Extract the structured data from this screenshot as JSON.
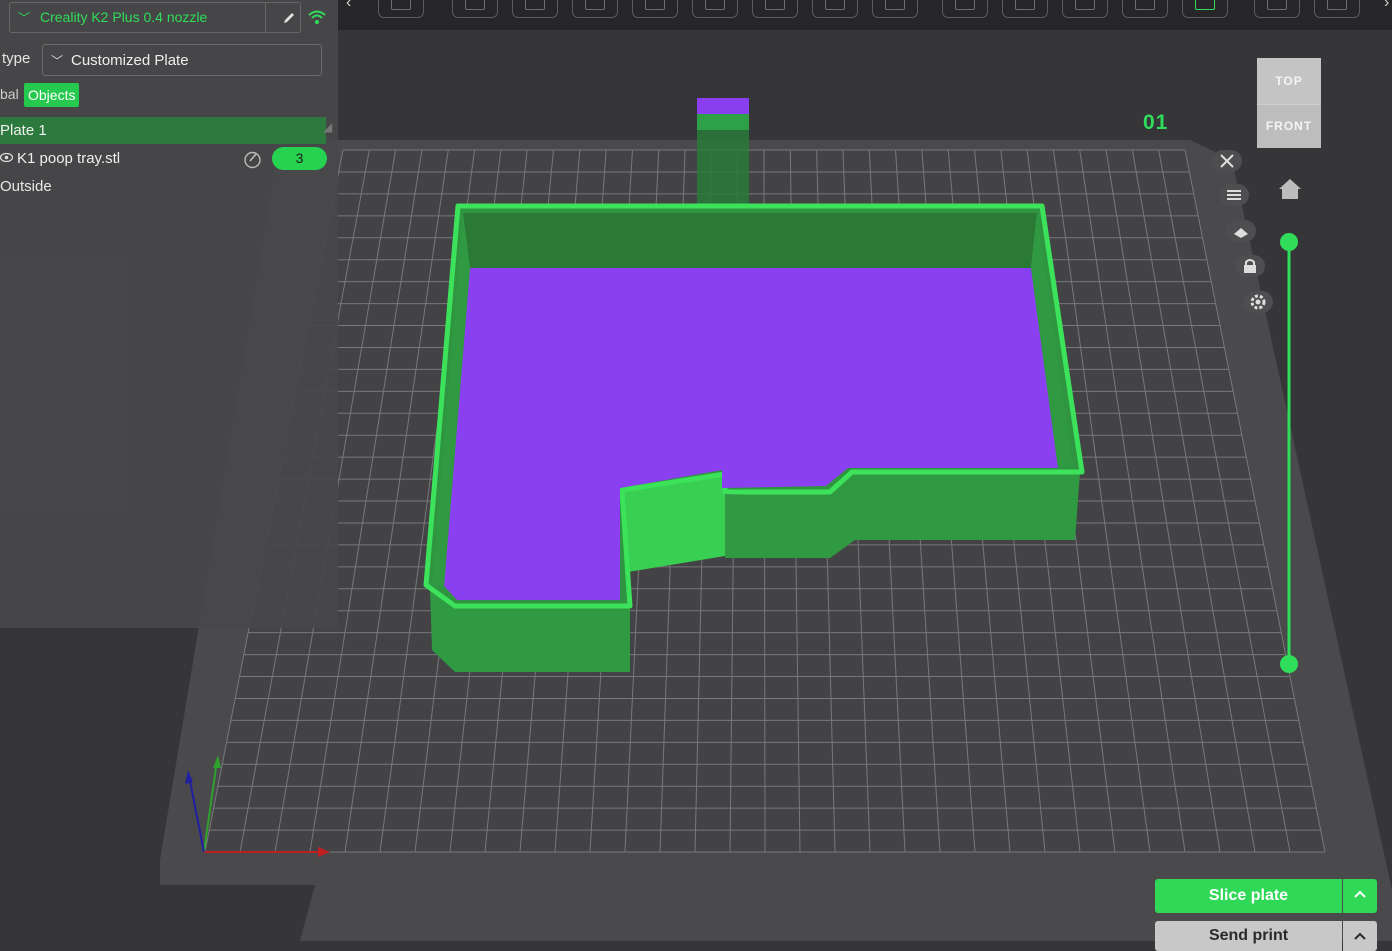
{
  "toolbar": {
    "buttons": [
      "add-icon",
      "arrange-icon",
      "orient-icon",
      "cut-icon",
      "layers-icon",
      "paint-icon",
      "support-icon",
      "scale-icon",
      "measure-icon",
      "seam-icon",
      "fill-icon",
      "text-icon",
      "plate-icon",
      "auto-icon",
      "printer-icon"
    ]
  },
  "left_panel": {
    "printer": "Creality K2 Plus 0.4 nozzle",
    "plate_type_label": "type",
    "plate_type_value": "Customized Plate",
    "tab_global": "bal",
    "tab_objects": "Objects",
    "plate": "Plate 1",
    "object_name": "K1 poop tray.stl",
    "object_count": "3",
    "outside": "Outside"
  },
  "viewport": {
    "plate_number": "01",
    "navcube_top": "TOP",
    "navcube_front": "FRONT"
  },
  "actions": {
    "slice": "Slice plate",
    "send": "Send print"
  },
  "colors": {
    "accent": "#2fdd5a",
    "model_green": "#2f8f3f",
    "model_purple": "#8a3ff0"
  }
}
